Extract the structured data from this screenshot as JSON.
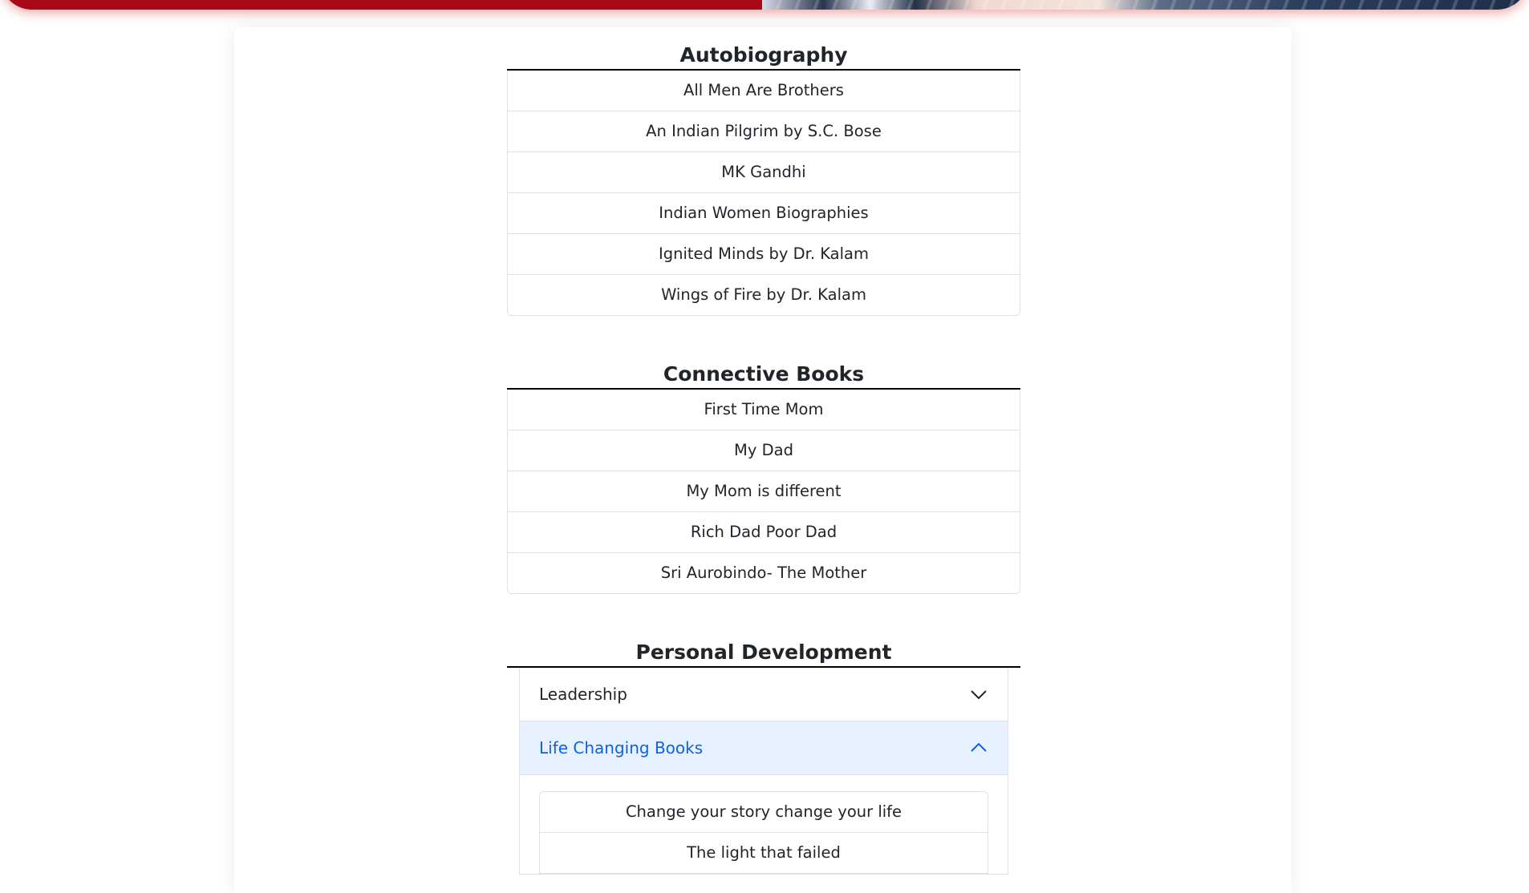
{
  "sections": {
    "autobiography": {
      "title": "Autobiography",
      "items": [
        "All Men Are Brothers",
        "An Indian Pilgrim by S.C. Bose",
        "MK Gandhi",
        "Indian Women Biographies",
        "Ignited Minds by Dr. Kalam",
        "Wings of Fire by Dr. Kalam"
      ]
    },
    "connective": {
      "title": "Connective Books",
      "items": [
        "First Time Mom",
        "My Dad",
        "My Mom is different",
        "Rich Dad Poor Dad",
        "Sri Aurobindo- The Mother"
      ]
    },
    "personal": {
      "title": "Personal Development",
      "accordion": [
        {
          "label": "Leadership",
          "state": "collapsed",
          "icon": "chevron-down-icon"
        },
        {
          "label": "Life Changing Books",
          "state": "expanded",
          "icon": "chevron-up-icon"
        }
      ],
      "expanded_items": [
        "Change your story change your life",
        "The light that failed"
      ]
    }
  },
  "colors": {
    "banner_red": "#a50a15",
    "accordion_active_bg": "#e7f1ff",
    "accordion_active_text": "#0c63e4"
  }
}
